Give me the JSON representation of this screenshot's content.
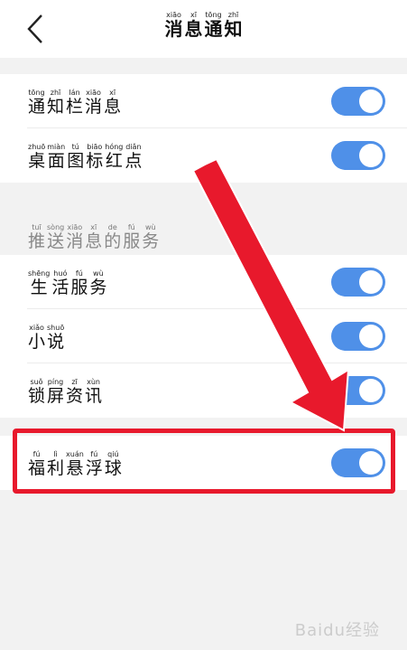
{
  "header": {
    "title": [
      {
        "py": "xiāo",
        "hz": "消"
      },
      {
        "py": "xī",
        "hz": "息"
      },
      {
        "py": "tōng",
        "hz": "通"
      },
      {
        "py": "zhī",
        "hz": "知"
      }
    ]
  },
  "rows_top": [
    {
      "label": [
        {
          "py": "tōng",
          "hz": "通"
        },
        {
          "py": "zhī",
          "hz": "知"
        },
        {
          "py": "lán",
          "hz": "栏"
        },
        {
          "py": "xiāo",
          "hz": "消"
        },
        {
          "py": "xī",
          "hz": "息"
        }
      ],
      "enabled": true
    },
    {
      "label": [
        {
          "py": "zhuō",
          "hz": "桌"
        },
        {
          "py": "miàn",
          "hz": "面"
        },
        {
          "py": "tú",
          "hz": "图"
        },
        {
          "py": "biāo",
          "hz": "标"
        },
        {
          "py": "hóng",
          "hz": "红"
        },
        {
          "py": "diǎn",
          "hz": "点"
        }
      ],
      "enabled": true
    }
  ],
  "push_section": {
    "title": [
      {
        "py": "tuī",
        "hz": "推"
      },
      {
        "py": "sòng",
        "hz": "送"
      },
      {
        "py": "xiāo",
        "hz": "消"
      },
      {
        "py": "xī",
        "hz": "息"
      },
      {
        "py": "de",
        "hz": "的"
      },
      {
        "py": "fú",
        "hz": "服"
      },
      {
        "py": "wù",
        "hz": "务"
      }
    ],
    "rows": [
      {
        "label": [
          {
            "py": "shēng",
            "hz": "生"
          },
          {
            "py": "huó",
            "hz": "活"
          },
          {
            "py": "fú",
            "hz": "服"
          },
          {
            "py": "wù",
            "hz": "务"
          }
        ],
        "enabled": true
      },
      {
        "label": [
          {
            "py": "xiǎo",
            "hz": "小"
          },
          {
            "py": "shuō",
            "hz": "说"
          }
        ],
        "enabled": true
      },
      {
        "label": [
          {
            "py": "suǒ",
            "hz": "锁"
          },
          {
            "py": "píng",
            "hz": "屏"
          },
          {
            "py": "zī",
            "hz": "资"
          },
          {
            "py": "xùn",
            "hz": "讯"
          }
        ],
        "enabled": true
      }
    ]
  },
  "bottom_row": {
    "label": [
      {
        "py": "fú",
        "hz": "福"
      },
      {
        "py": "lì",
        "hz": "利"
      },
      {
        "py": "xuán",
        "hz": "悬"
      },
      {
        "py": "fú",
        "hz": "浮"
      },
      {
        "py": "qiú",
        "hz": "球"
      }
    ],
    "enabled": true
  },
  "watermark": "Baidu经验",
  "colors": {
    "toggle_on": "#4f90e8",
    "highlight": "#e8192c",
    "background": "#f2f2f2"
  }
}
